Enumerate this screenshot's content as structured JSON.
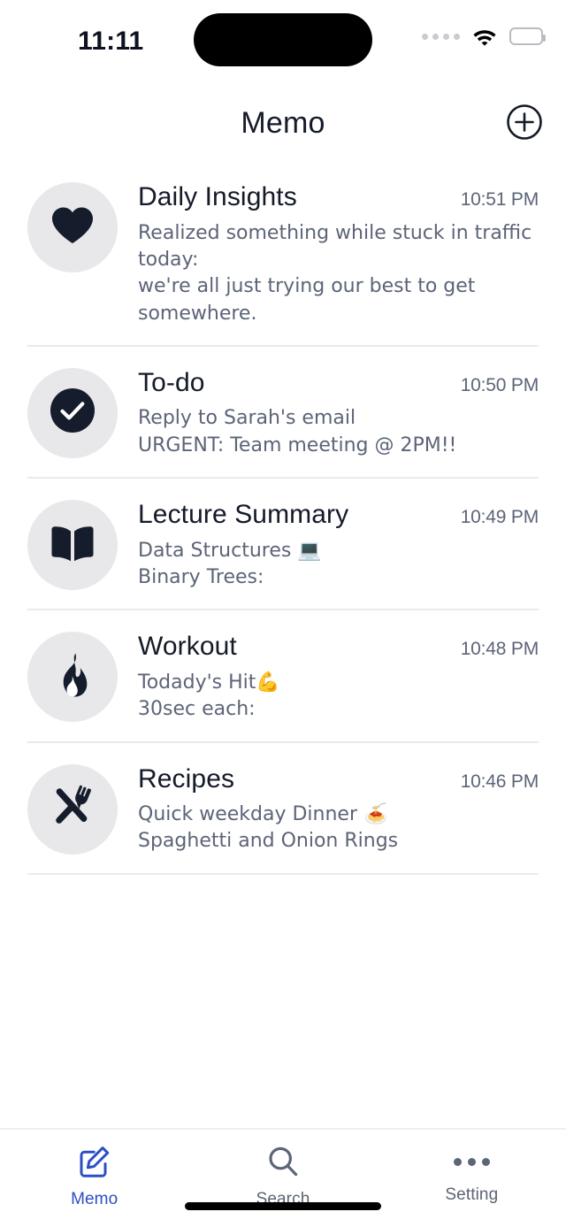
{
  "statusbar": {
    "time": "11:11",
    "signal_icon": "signal-dots-icon",
    "wifi_icon": "wifi-icon",
    "battery_icon": "battery-icon"
  },
  "header": {
    "title": "Memo",
    "add_icon": "plus-circle-icon"
  },
  "colors": {
    "accent": "#2b4fc4",
    "ink": "#141a28",
    "muted": "#5c6477",
    "avatar_bg": "#e8e8ea",
    "divider": "#e9eaec"
  },
  "memos": [
    {
      "icon": "heart-icon",
      "title": "Daily Insights",
      "time": "10:51 PM",
      "lines": [
        "Realized something while stuck in traffic today:",
        "we're all just trying our best to get somewhere."
      ]
    },
    {
      "icon": "check-circle-icon",
      "title": "To-do",
      "time": "10:50 PM",
      "lines": [
        "Reply to Sarah's email",
        "URGENT: Team meeting @ 2PM!!"
      ]
    },
    {
      "icon": "open-book-icon",
      "title": "Lecture Summary",
      "time": "10:49 PM",
      "lines": [
        "Data Structures 💻",
        "Binary Trees:"
      ]
    },
    {
      "icon": "flame-icon",
      "title": "Workout",
      "time": "10:48 PM",
      "lines": [
        "Todady's Hit💪",
        "30sec each:"
      ]
    },
    {
      "icon": "fork-knife-icon",
      "title": "Recipes",
      "time": "10:46 PM",
      "lines": [
        "Quick weekday Dinner 🍝",
        "Spaghetti and Onion Rings"
      ]
    }
  ],
  "tabbar": {
    "tabs": [
      {
        "label": "Memo",
        "icon": "pencil-square-icon",
        "active": true
      },
      {
        "label": "Search",
        "icon": "search-icon",
        "active": false
      },
      {
        "label": "Setting",
        "icon": "ellipsis-icon",
        "active": false
      }
    ]
  }
}
